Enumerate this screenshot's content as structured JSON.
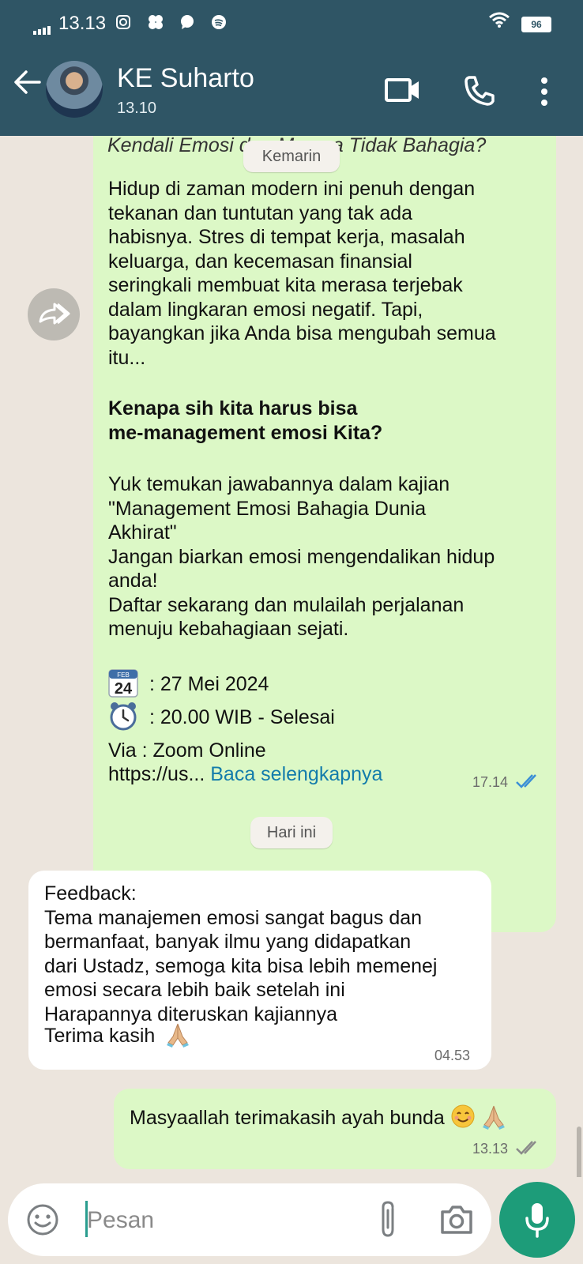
{
  "status_bar": {
    "time": "13.13",
    "battery": "96"
  },
  "header": {
    "contact_name": "KE Suharto",
    "last_seen": "13.10"
  },
  "chat": {
    "forwarded_message": {
      "clipped_title": "Kendali Emosi dan Merasa Tidak Bahagia?",
      "paragraph1": "Hidup di zaman modern ini penuh dengan\ntekanan dan tuntutan yang tak ada\nhabisnya. Stres di tempat kerja, masalah\nkeluarga, dan kecemasan finansial\nseringkali membuat kita merasa terjebak\ndalam lingkaran emosi negatif. Tapi,\nbayangkan jika Anda bisa mengubah semua\nitu...",
      "heading": "Kenapa sih kita harus bisa\nme-management emosi Kita?",
      "paragraph2": "Yuk temukan jawabannya dalam kajian\n\"Management Emosi Bahagia Dunia\nAkhirat\"\nJangan biarkan emosi mengendalikan hidup\nanda!\nDaftar sekarang dan mulailah perjalanan\nmenuju kebahagiaan sejati.",
      "calendar_emoji_text": "24",
      "calendar_emoji_month": "FEB",
      "event_date": ": 27 Mei 2024",
      "event_time": ": 20.00 WIB - Selesai",
      "event_via": "Via : Zoom Online",
      "truncated_link": "https://us...",
      "read_more": "Baca selengkapnya",
      "time": "17.14"
    },
    "date_separator_yesterday": "Kemarin",
    "date_separator_today": "Hari ini",
    "incoming_message": {
      "text": "Feedback:\nTema manajemen emosi sangat bagus dan\nbermanfaat, banyak ilmu yang didapatkan\ndari Ustadz, semoga kita bisa lebih memenej\nemosi secara lebih baik setelah ini\nHarapannya diteruskan kajiannya",
      "closing": "Terima kasih",
      "time": "04.53"
    },
    "outgoing_message": {
      "text": "Masyaallah terimakasih ayah bunda",
      "time": "13.13"
    }
  },
  "composer": {
    "placeholder": "Pesan"
  },
  "colors": {
    "header_bg": "#2f5565",
    "outgoing_bubble": "#dcf8c6",
    "incoming_bubble": "#ffffff",
    "link": "#137cab",
    "read_ticks": "#3b8fd6",
    "mic_button": "#1d9c79"
  },
  "icons": {
    "back": "back-arrow-icon",
    "video": "video-call-icon",
    "call": "phone-icon",
    "menu": "more-vert-icon",
    "forward": "forward-icon",
    "emoji": "emoji-icon",
    "attach": "paperclip-icon",
    "camera": "camera-icon",
    "mic": "mic-icon"
  }
}
